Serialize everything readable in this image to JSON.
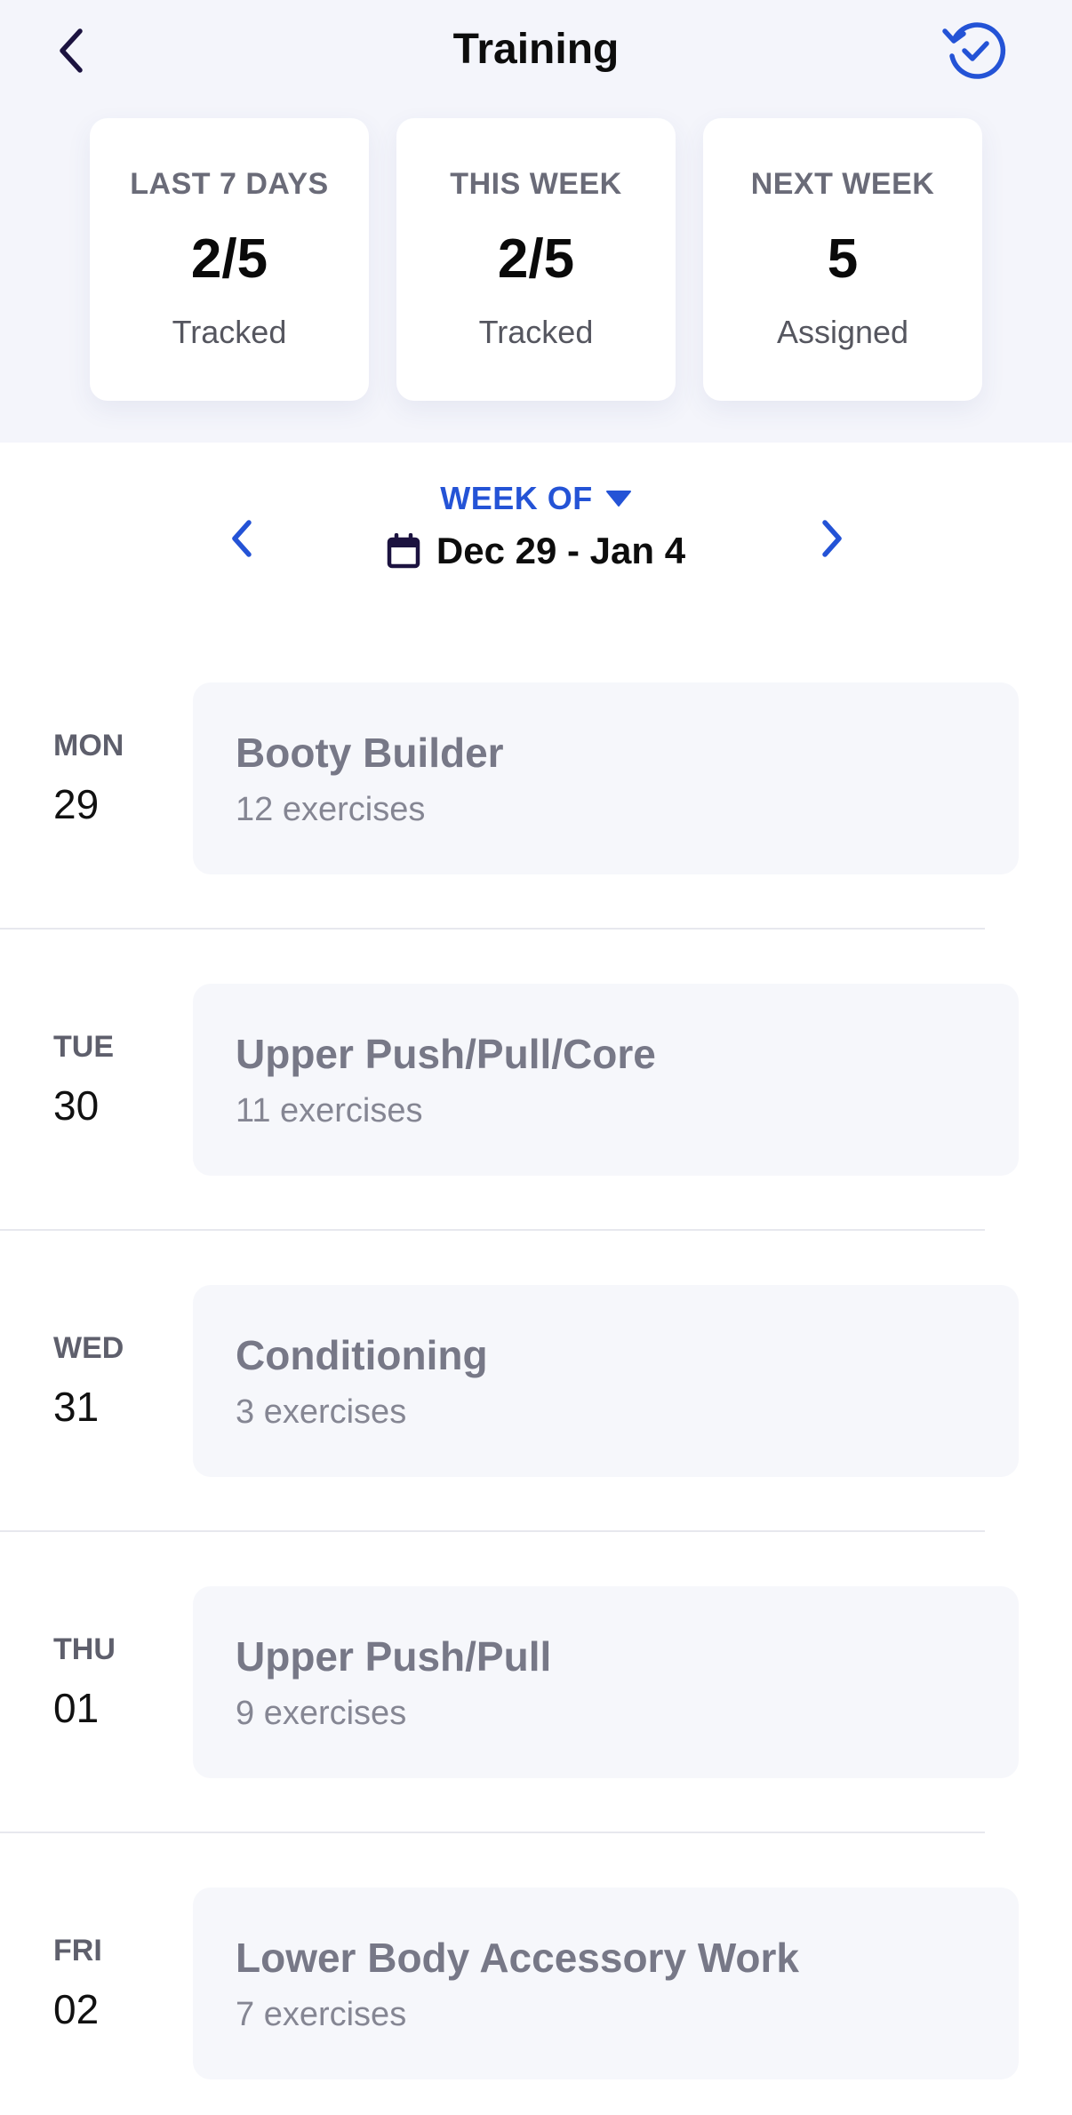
{
  "header": {
    "title": "Training",
    "back_icon": "chevron-left-icon",
    "history_icon": "clock-check-icon"
  },
  "colors": {
    "accent": "#2453d6",
    "background_top": "#f4f5fb",
    "card": "#ffffff",
    "workout_card": "#f6f7fb"
  },
  "stats": [
    {
      "label": "LAST 7 DAYS",
      "value": "2/5",
      "sub": "Tracked"
    },
    {
      "label": "THIS WEEK",
      "value": "2/5",
      "sub": "Tracked"
    },
    {
      "label": "NEXT WEEK",
      "value": "5",
      "sub": "Assigned"
    }
  ],
  "week": {
    "label": "WEEK OF",
    "range": "Dec 29 - Jan 4"
  },
  "days": [
    {
      "day": "MON",
      "date": "29",
      "workout": "Booty Builder",
      "exercises": "12 exercises"
    },
    {
      "day": "TUE",
      "date": "30",
      "workout": "Upper Push/Pull/Core",
      "exercises": "11 exercises"
    },
    {
      "day": "WED",
      "date": "31",
      "workout": "Conditioning",
      "exercises": "3 exercises"
    },
    {
      "day": "THU",
      "date": "01",
      "workout": "Upper Push/Pull",
      "exercises": "9 exercises"
    },
    {
      "day": "FRI",
      "date": "02",
      "workout": "Lower Body Accessory Work",
      "exercises": "7 exercises"
    }
  ]
}
